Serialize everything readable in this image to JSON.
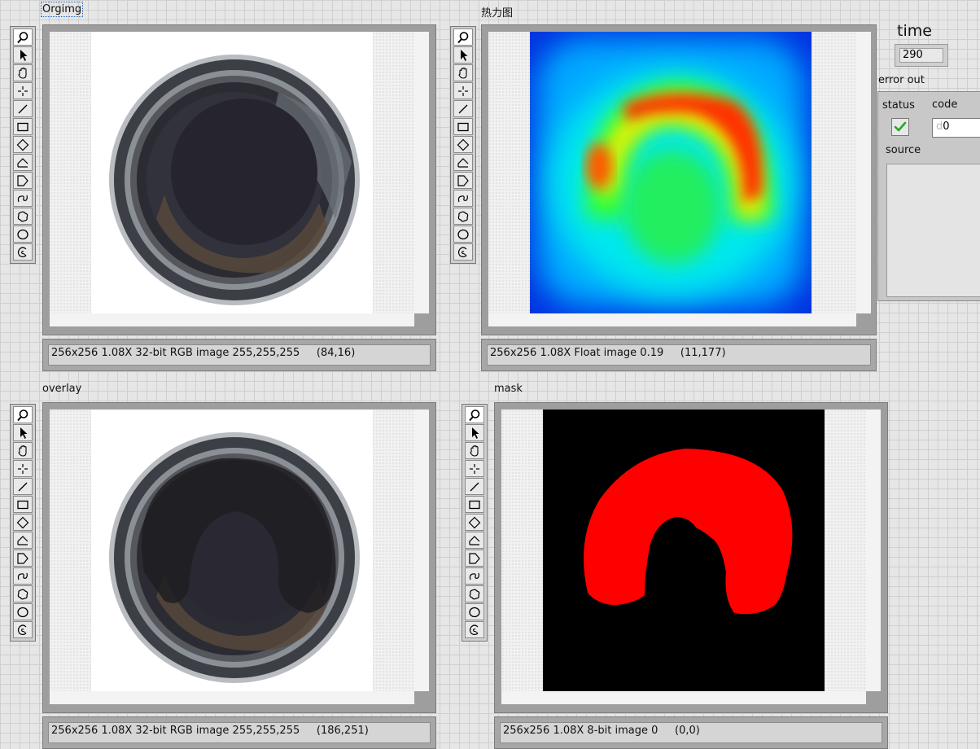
{
  "labels": {
    "orgimg": "Orgimg",
    "heatmap": "热力图",
    "overlay": "overlay",
    "mask": "mask",
    "time": "time",
    "error_out": "error out",
    "status": "status",
    "code": "code",
    "source": "source"
  },
  "time_value": "290",
  "error": {
    "status_icon": "checkmark-icon",
    "code_prefix": "d",
    "code_value": "0",
    "source_value": ""
  },
  "status_bars": {
    "orgimg": "256x256 1.08X 32-bit RGB image 255,255,255     (84,16)",
    "heatmap": "256x256 1.08X Float image 0.19     (11,177)",
    "overlay": "256x256 1.08X 32-bit RGB image 255,255,255     (186,251)",
    "mask": "256x256 1.08X 8-bit image 0     (0,0)"
  },
  "tools": [
    "zoom-icon",
    "pointer-icon",
    "pan-hand-icon",
    "point-crosshair-icon",
    "line-icon",
    "rectangle-icon",
    "rotated-rect-icon",
    "polyline-icon",
    "polygon-icon",
    "freehand-line-icon",
    "freehand-region-icon",
    "oval-icon",
    "annulus-icon"
  ],
  "colors": {
    "mask_region": "#ff0000",
    "mask_background": "#000000",
    "status_ok": "#22aa22"
  }
}
